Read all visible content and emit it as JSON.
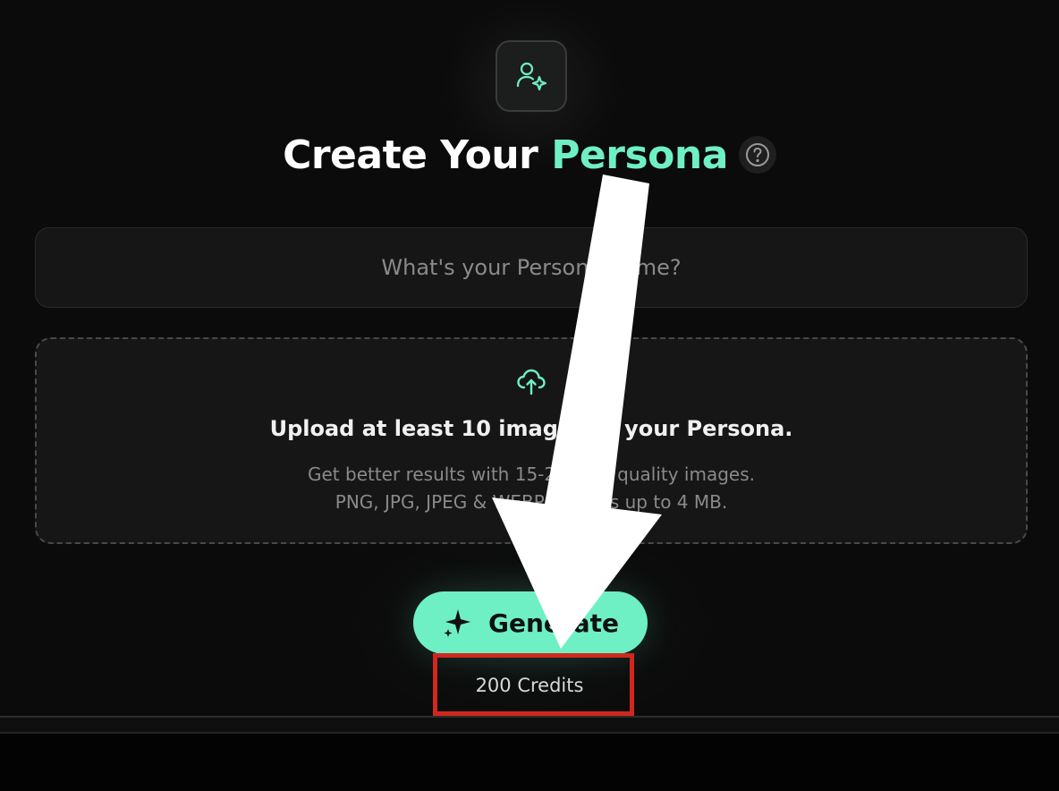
{
  "title": {
    "prefix": "Create Your",
    "accent": "Persona"
  },
  "icons": {
    "header": "user-sparkle-icon",
    "help": "question-circle-icon",
    "upload": "cloud-upload-icon",
    "generate": "sparkle-icon"
  },
  "name_field": {
    "placeholder": "What's your Persona name?",
    "value": ""
  },
  "upload": {
    "title": "Upload at least 10 images of your Persona.",
    "hint_line1": "Get better results with 15-20 high quality images.",
    "hint_line2": "PNG, JPG, JPEG & WEBP formats up to 4 MB."
  },
  "generate": {
    "label": "Generate",
    "credits": "200 Credits"
  },
  "colors": {
    "accent": "#6ff0c4",
    "background": "#0b0b0b",
    "annotation_box": "#d0281e",
    "annotation_arrow": "#ffffff"
  }
}
